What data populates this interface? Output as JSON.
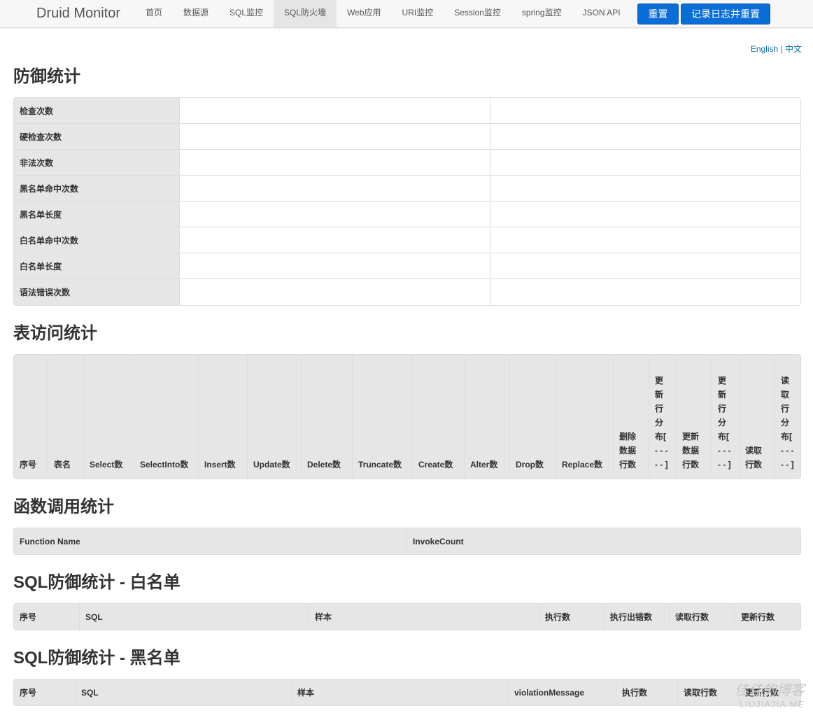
{
  "app": {
    "brand": "Druid Monitor",
    "nav": [
      {
        "label": "首页"
      },
      {
        "label": "数据源"
      },
      {
        "label": "SQL监控"
      },
      {
        "label": "SQL防火墙",
        "active": true
      },
      {
        "label": "Web应用"
      },
      {
        "label": "URI监控"
      },
      {
        "label": "Session监控"
      },
      {
        "label": "spring监控"
      },
      {
        "label": "JSON API"
      }
    ],
    "reset_label": "重置",
    "log_reset_label": "记录日志并重置",
    "accent": "#0a6ed6"
  },
  "lang": {
    "english": "English",
    "separator": "|",
    "chinese": "中文"
  },
  "defense": {
    "title": "防御统计",
    "rows": [
      "检查次数",
      "硬检查次数",
      "非法次数",
      "黑名单命中次数",
      "黑名单长度",
      "白名单命中次数",
      "白名单长度",
      "语法错误次数"
    ]
  },
  "table_access": {
    "title": "表访问统计",
    "headers": [
      "序号",
      "表名",
      "Select数",
      "SelectInto数",
      "Insert数",
      "Update数",
      "Delete数",
      "Truncate数",
      "Create数",
      "Alter数",
      "Drop数",
      "Replace数",
      "删除数据行数",
      "更新行分布[ - - - - - ]",
      "更新数据行数",
      "更新行分布[ - - - - - ]",
      "读取行数",
      "读取行分布[ - - - - - ]"
    ]
  },
  "functions": {
    "title": "函数调用统计",
    "headers": [
      "Function Name",
      "InvokeCount"
    ]
  },
  "whitelist": {
    "title": "SQL防御统计 - 白名单",
    "headers": [
      "序号",
      "SQL",
      "样本",
      "执行数",
      "执行出错数",
      "读取行数",
      "更新行数"
    ]
  },
  "blacklist": {
    "title": "SQL防御统计 - 黑名单",
    "headers": [
      "序号",
      "SQL",
      "样本",
      "violationMessage",
      "执行数",
      "读取行数",
      "更新行数"
    ]
  },
  "watermark": {
    "text": "佳佳的博客",
    "sub": "LIUJIAJIA.ME"
  }
}
